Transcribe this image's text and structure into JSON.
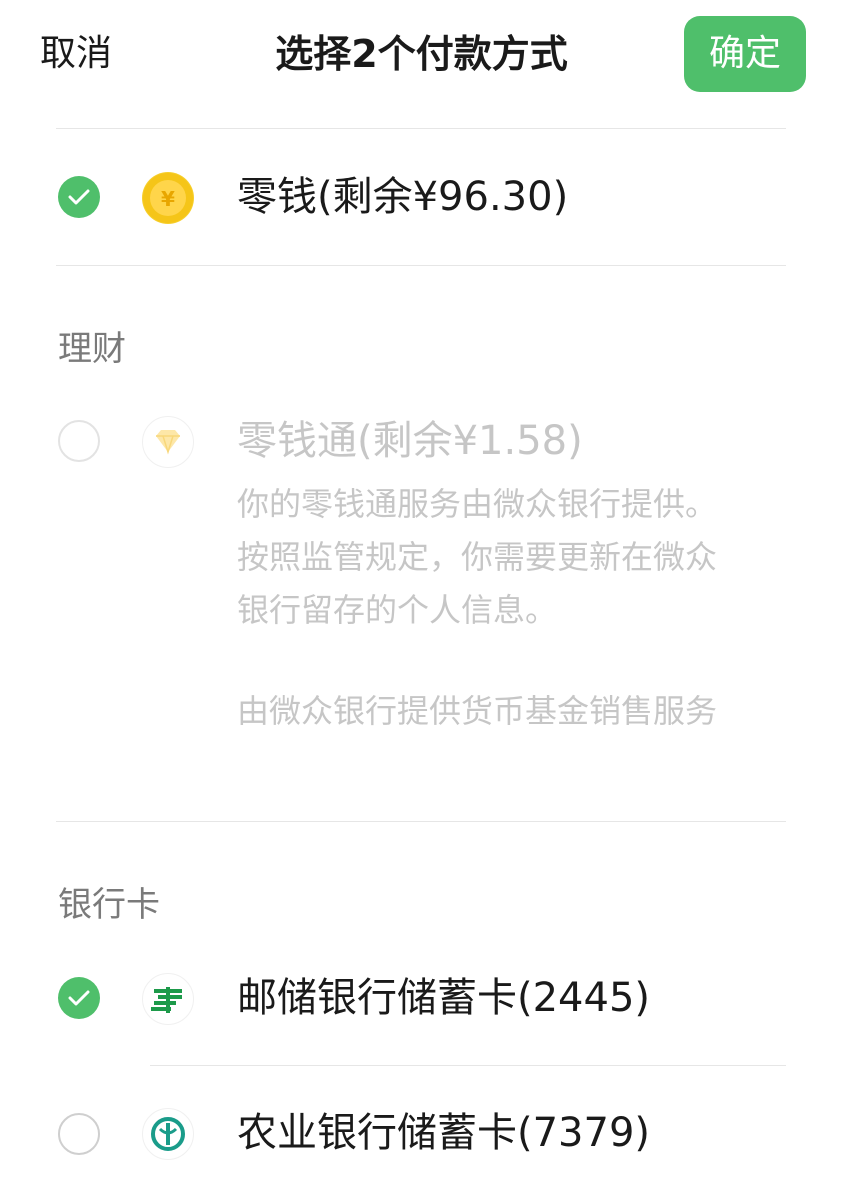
{
  "header": {
    "cancel_label": "取消",
    "title": "选择2个付款方式",
    "confirm_label": "确定"
  },
  "wallet": {
    "label": "零钱(剩余¥96.30)",
    "icon": "yuan-coin-icon",
    "selected": true
  },
  "finance": {
    "section_label": "理财",
    "item": {
      "label": "零钱通(剩余¥1.58)",
      "icon": "diamond-icon",
      "disabled": true,
      "notice": "你的零钱通服务由微众银行提供。按照监管规定，你需要更新在微众银行留存的个人信息。",
      "provider_note": "由微众银行提供货币基金销售服务"
    }
  },
  "bank_cards": {
    "section_label": "银行卡",
    "items": [
      {
        "label": "邮储银行储蓄卡(2445)",
        "icon": "psbc-logo-icon",
        "selected": true
      },
      {
        "label": "农业银行储蓄卡(7379)",
        "icon": "abc-logo-icon",
        "selected": false
      }
    ]
  },
  "colors": {
    "accent": "#4fbf6b",
    "disabled_text": "#c6c6c6",
    "section_text": "#7a7a7a"
  }
}
